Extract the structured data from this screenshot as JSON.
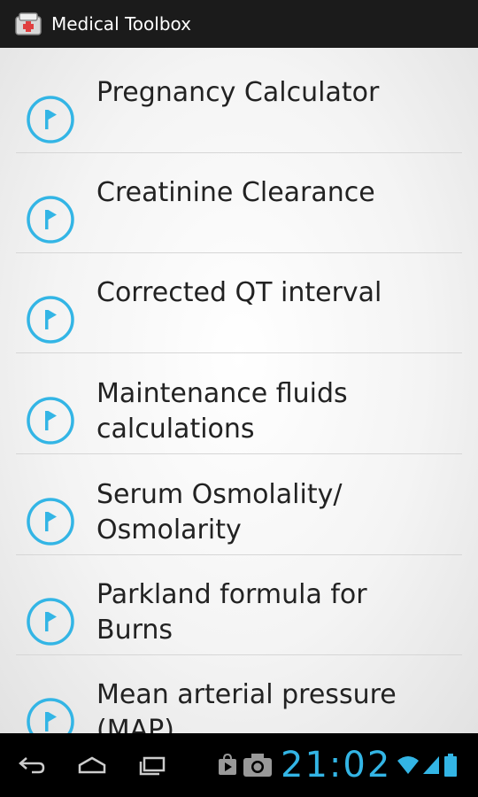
{
  "app": {
    "title": "Medical Toolbox"
  },
  "list": {
    "items": [
      {
        "label": "Pregnancy Calculator"
      },
      {
        "label": "Creatinine Clearance"
      },
      {
        "label": "Corrected QT interval"
      },
      {
        "label": "Maintenance fluids calculations"
      },
      {
        "label": "Serum Osmolality/ Osmolarity"
      },
      {
        "label": "Parkland formula for Burns"
      },
      {
        "label": "Mean arterial pressure (MAP)"
      }
    ]
  },
  "status": {
    "time": "21:02"
  },
  "colors": {
    "accent": "#33b5e5",
    "titlebar": "#1b1b1b",
    "text": "#222222"
  },
  "icons": {
    "row": "flag-circle-icon",
    "back": "back-icon",
    "home": "home-icon",
    "recents": "recent-apps-icon"
  }
}
